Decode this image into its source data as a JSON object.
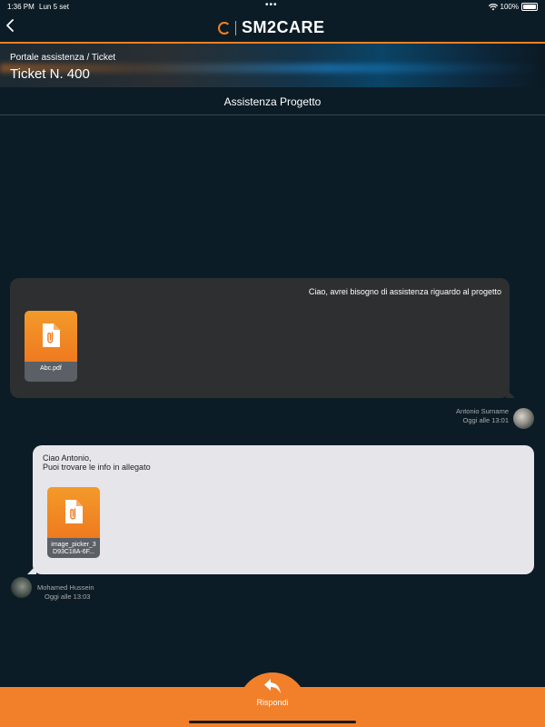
{
  "status_bar": {
    "time": "1:36 PM",
    "date": "Lun 5 set",
    "dots": "•••",
    "battery": "100%",
    "icons": [
      "wifi-icon",
      "battery-icon"
    ]
  },
  "nav": {
    "back_icon": "chevron-left-icon",
    "logo_text": "SM2CARE",
    "accent_color": "#f28022"
  },
  "banner": {
    "breadcrumb": "Portale assistenza / Ticket",
    "title": "Ticket N. 400"
  },
  "section": {
    "title": "Assistenza Progetto"
  },
  "messages": [
    {
      "text": "Ciao, avrei bisogno di assistenza riguardo al progetto",
      "attachment": {
        "name": "Abc.pdf",
        "icon": "paperclip-file-icon"
      },
      "author": "Antonio Surname",
      "timestamp": "Oggi alle 13:01"
    },
    {
      "text_lines": [
        "Ciao Antonio,",
        "Puoi trovare le info in allegato"
      ],
      "attachment": {
        "name": "image_picker_3D93C18A-6F...",
        "icon": "paperclip-file-icon"
      },
      "author": "Mohamed Hussein",
      "timestamp": "Oggi alle 13:03"
    }
  ],
  "footer": {
    "reply_label": "Rispondi",
    "reply_icon": "reply-arrow-icon"
  }
}
